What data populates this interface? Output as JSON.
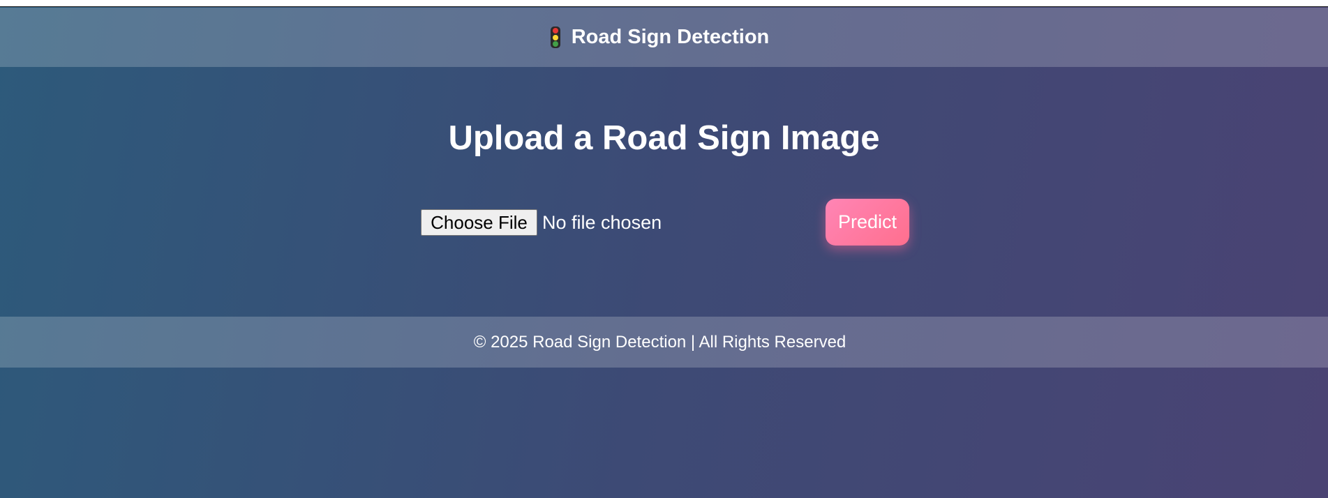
{
  "header": {
    "icon": "traffic-light-icon",
    "title": "Road Sign Detection"
  },
  "main": {
    "title": "Upload a Road Sign Image",
    "file_input": {
      "button_label": "Choose File",
      "status": "No file chosen"
    },
    "predict_label": "Predict"
  },
  "footer": {
    "text": "© 2025 Road Sign Detection | All Rights Reserved"
  },
  "colors": {
    "predict_button": "#ff7fa4",
    "background_start": "#2d5a7b",
    "background_end": "#4a4373"
  }
}
